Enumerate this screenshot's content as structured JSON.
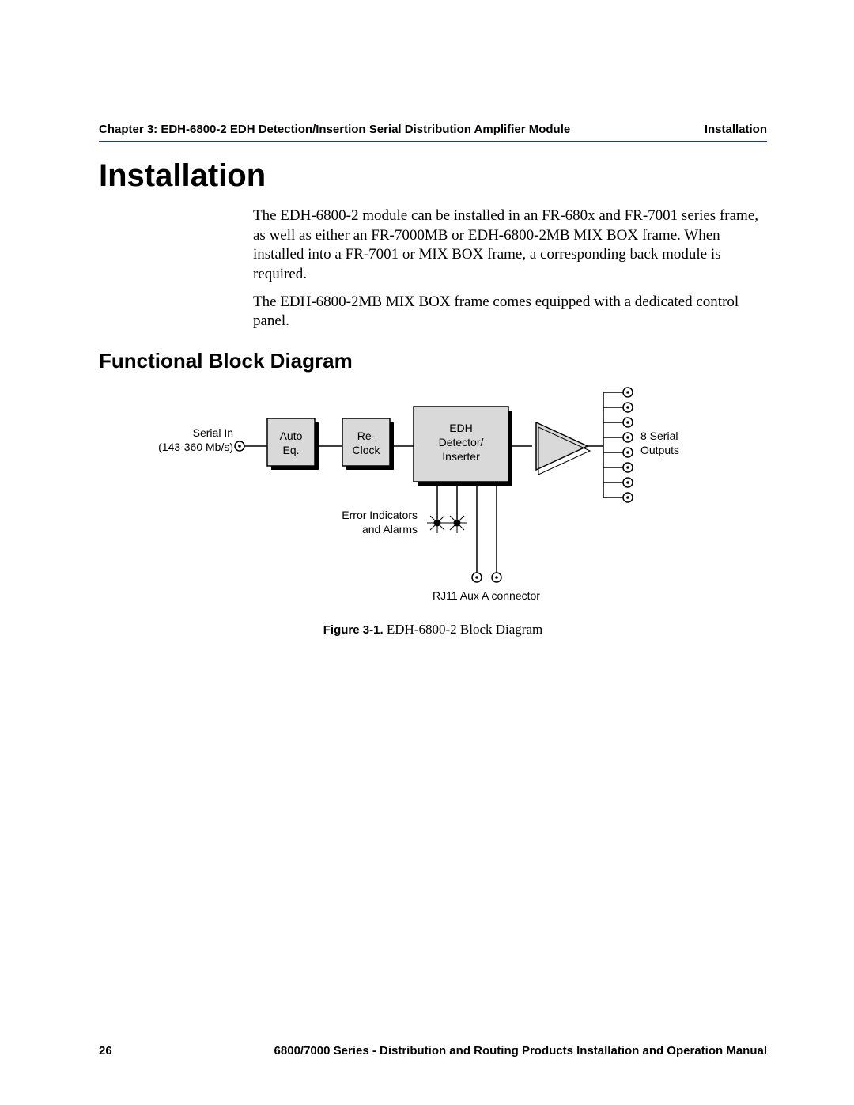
{
  "header": {
    "chapter": "Chapter 3: EDH-6800-2 EDH Detection/Insertion Serial Distribution Amplifier Module",
    "section": "Installation"
  },
  "title": "Installation",
  "para1": "The EDH-6800-2 module can be installed in an FR-680x and FR-7001 series frame, as well as either an FR-7000MB or EDH-6800-2MB MIX BOX frame. When installed into a FR-7001 or MIX BOX frame, a corresponding back module is required.",
  "para2": "The EDH-6800-2MB MIX BOX frame comes equipped with a dedicated control panel.",
  "subheading": "Functional Block Diagram",
  "diagram": {
    "input_label_1": "Serial In",
    "input_label_2": "(143-360 Mb/s)",
    "block_auto_1": "Auto",
    "block_auto_2": "Eq.",
    "block_reclock_1": "Re-",
    "block_reclock_2": "Clock",
    "block_edh_1": "EDH",
    "block_edh_2": "Detector/",
    "block_edh_3": "Inserter",
    "output_label_1": "8 Serial",
    "output_label_2": "Outputs",
    "indicators_1": "Error Indicators",
    "indicators_2": "and Alarms",
    "rj11": "RJ11 Aux A connector"
  },
  "figure": {
    "number": "Figure 3-1.",
    "title": " EDH-6800-2 Block Diagram"
  },
  "footer": {
    "page": "26",
    "manual": "6800/7000 Series - Distribution and Routing Products Installation and Operation Manual"
  }
}
